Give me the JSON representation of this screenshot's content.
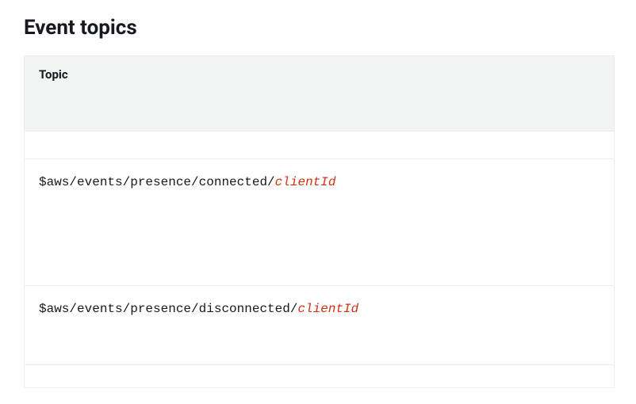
{
  "title": "Event topics",
  "table": {
    "header": "Topic",
    "rows": [
      {
        "prefix": "$aws/events/presence/connected/",
        "variable": "clientId"
      },
      {
        "prefix": "$aws/events/presence/disconnected/",
        "variable": "clientId"
      }
    ]
  }
}
